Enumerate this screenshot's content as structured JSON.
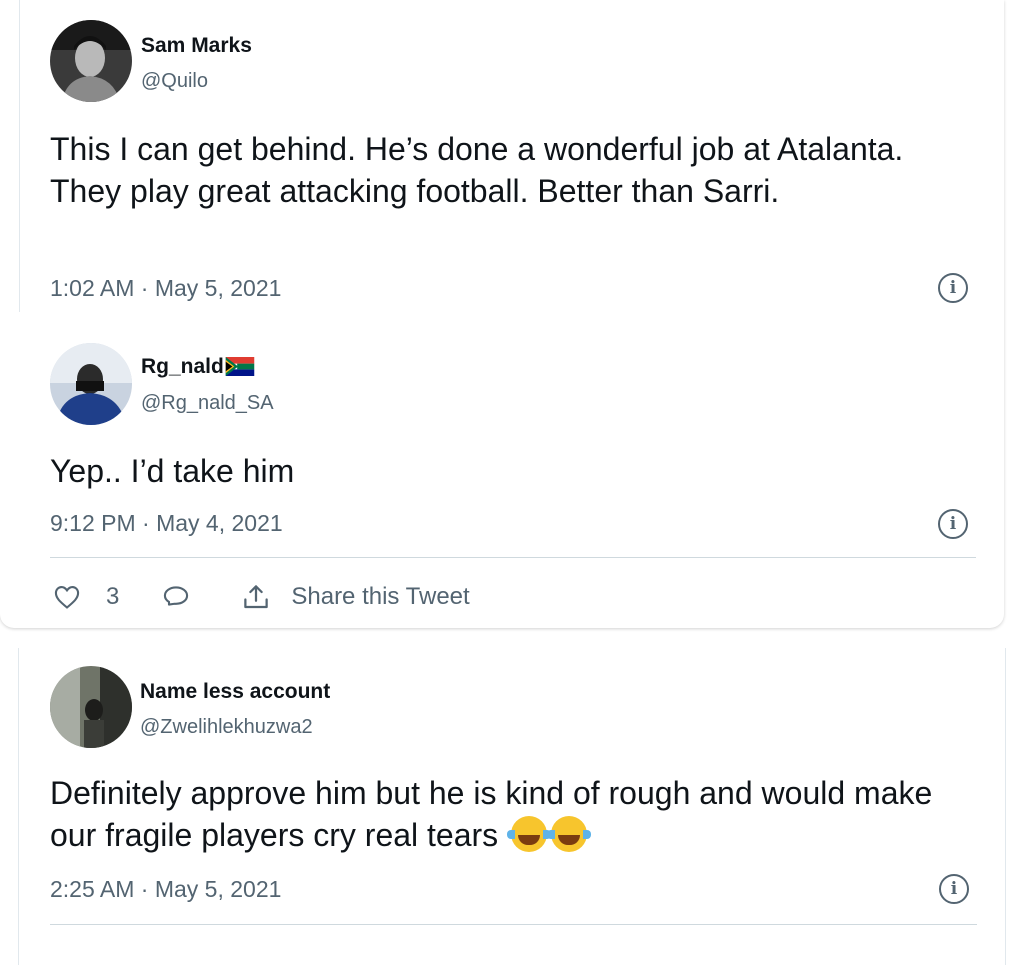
{
  "tweets": [
    {
      "name": "Sam Marks",
      "handle": "@Quilo",
      "text": "This I can get behind. He’s done a wonderful job at Atalanta. They play great attacking football. Better than Sarri.",
      "timestamp": "1:02 AM · May 5, 2021"
    },
    {
      "name": "Rg_nald",
      "handle": "@Rg_nald_SA",
      "text": "Yep.. I’d take him",
      "timestamp": "9:12 PM · May 4, 2021",
      "like_count": "3",
      "share_label": "Share this Tweet"
    },
    {
      "name": "Name less account",
      "handle": "@Zwelihlekhuzwa2",
      "text": "Definitely approve him but he is kind of rough and would make our fragile players cry real tears",
      "timestamp": "2:25 AM · May 5, 2021"
    }
  ],
  "icons": {
    "info": "info-icon",
    "like": "heart-icon",
    "reply": "reply-icon",
    "share": "share-icon",
    "flag": "south-africa-flag-icon",
    "emoji": "tears-of-joy-emoji"
  },
  "colors": {
    "text": "#0f1419",
    "secondary": "#536471",
    "divider": "#cfd9de"
  }
}
